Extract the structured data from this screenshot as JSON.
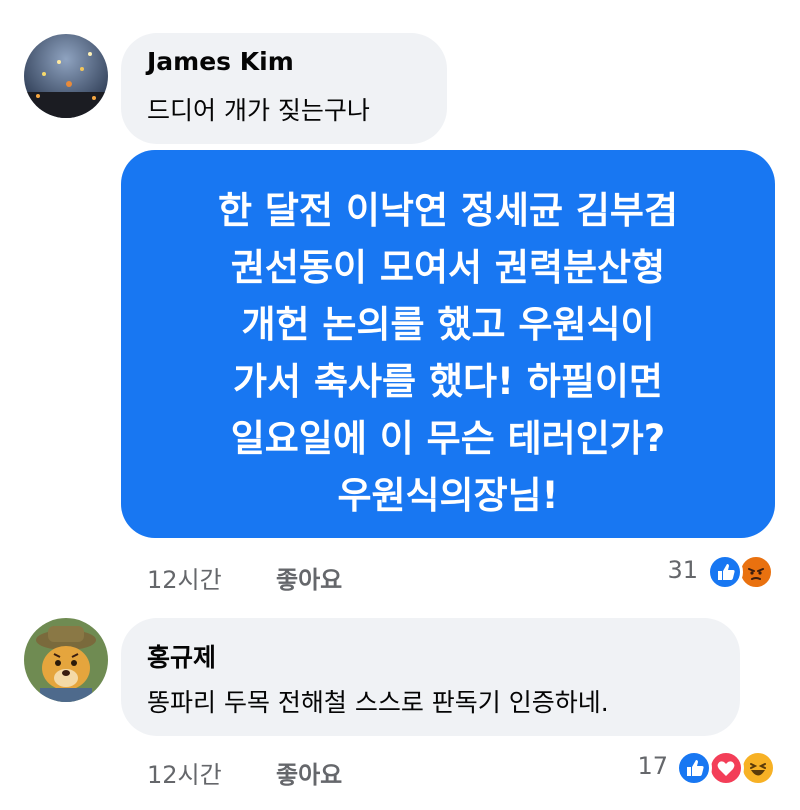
{
  "comments": [
    {
      "author": "James Kim",
      "text": "드디어 개가 짖는구나",
      "post_lines": [
        "한 달전 이낙연 정세균 김부겸",
        "권선동이 모여서 권력분산형",
        "개헌 논의를 했고 우원식이",
        "가서 축사를 했다! 하필이면",
        "일요일에 이 무슨 테러인가?",
        "우원식의장님!"
      ],
      "time": "12시간",
      "like_label": "좋아요",
      "reaction_count": "31",
      "reactions": [
        "like",
        "angry"
      ]
    },
    {
      "author": "홍규제",
      "text": "똥파리 두목 전해철 스스로 판독기 인증하네.",
      "time": "12시간",
      "like_label": "좋아요",
      "reaction_count": "17",
      "reactions": [
        "like",
        "love",
        "haha"
      ]
    }
  ],
  "colors": {
    "facebook_blue": "#1877f2",
    "bubble_gray": "#f0f2f5",
    "meta_gray": "#65676b",
    "love_red": "#f33e58",
    "angry_orange": "#e9710f",
    "haha_yellow": "#f7b125"
  }
}
